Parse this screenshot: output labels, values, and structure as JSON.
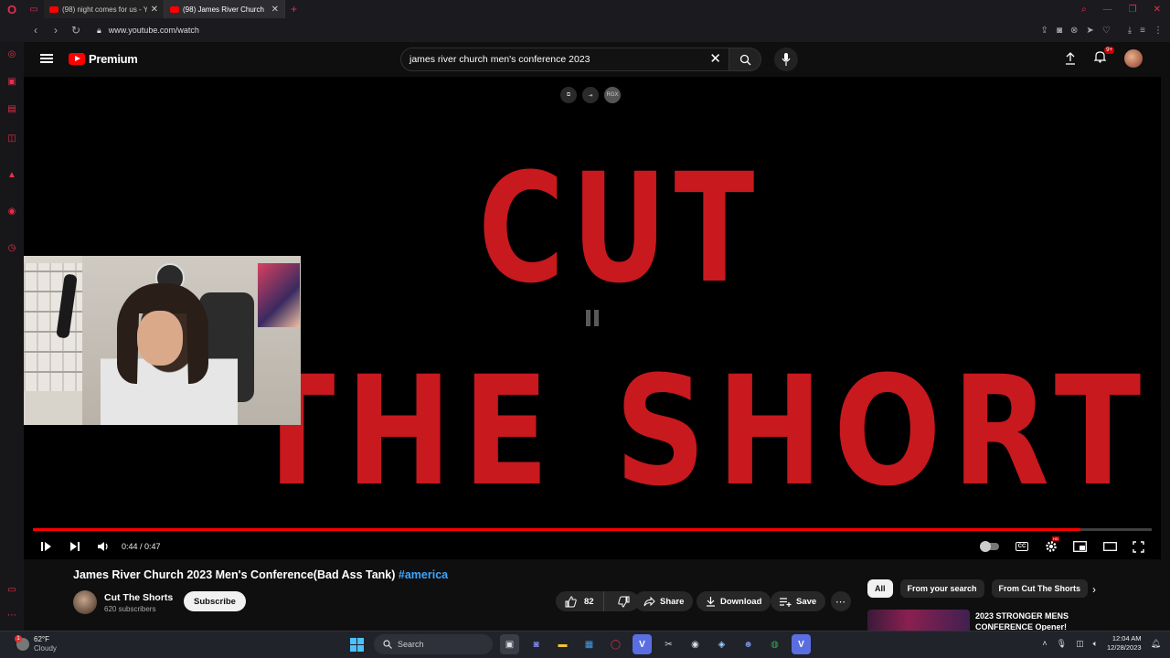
{
  "browser": {
    "tabs": [
      {
        "title": "(98) night comes for us - Y",
        "active": false
      },
      {
        "title": "(98) James River Church",
        "active": true
      }
    ],
    "url": "www.youtube.com/watch"
  },
  "youtube": {
    "brand": "Premium",
    "search": {
      "value": "james river church men's conference 2023"
    },
    "notifications_badge": "9+"
  },
  "player": {
    "overlay_button": "RGX",
    "frame_text_line1": "CUT",
    "frame_text_line2": "THE SHORTS",
    "time": "0:44 / 0:47",
    "progress": 0.936,
    "colors": {
      "title_red": "#c8191e",
      "progress_red": "#ff0000"
    }
  },
  "video": {
    "title": "James River Church 2023 Men's Conference(Bad Ass Tank)",
    "hashtag": "#america",
    "channel": "Cut The Shorts",
    "subscribers": "620 subscribers",
    "subscribe_label": "Subscribe",
    "likes": "82",
    "share_label": "Share",
    "download_label": "Download",
    "save_label": "Save"
  },
  "related": {
    "chips": [
      "All",
      "From your search",
      "From Cut The Shorts"
    ],
    "first_title": "2023 STRONGER MENS CONFERENCE Opener!"
  },
  "taskbar": {
    "temperature": "62°F",
    "condition": "Cloudy",
    "weather_badge": "1",
    "search_label": "Search",
    "time": "12:04 AM",
    "date": "12/28/2023"
  }
}
